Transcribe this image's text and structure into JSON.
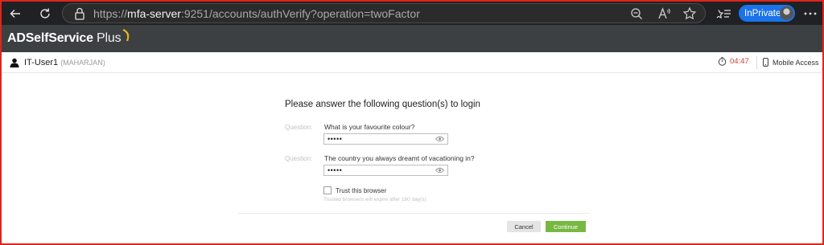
{
  "browser": {
    "url_prefix": "https://",
    "url_host": "mfa-server",
    "url_rest": ":9251/accounts/authVerify?operation=twoFactor",
    "inprivate_label": "InPrivate",
    "icons": [
      "back-arrow-icon",
      "refresh-icon",
      "lock-icon",
      "zoom-out-icon",
      "read-aloud-icon",
      "favorite-star-icon",
      "favorites-icon",
      "more-menu-icon"
    ]
  },
  "app": {
    "logo_main": "ADSelfService",
    "logo_plus": " Plus",
    "brand_colors": {
      "header_bg": "#3d4043",
      "accent_swoosh": "#e8b21c",
      "continue_green": "#77b843"
    }
  },
  "user_bar": {
    "user_name": "IT-User1",
    "user_domain": "(MAHARJAN)",
    "timer": "04:47",
    "mobile_access": "Mobile Access"
  },
  "form": {
    "title": "Please answer the following question(s) to login",
    "questions": [
      {
        "label": "Question:",
        "text": "What is your favourite colour?",
        "answer_masked": "•••••"
      },
      {
        "label": "Question:",
        "text": "The country you always dreamt of vacationing in?",
        "answer_masked": "•••••"
      }
    ],
    "trust_label": "Trust this browser",
    "trust_note": "Trusted browsers will expire after 180 day(s)",
    "trust_checked": false,
    "cancel_label": "Cancel",
    "continue_label": "Continue"
  }
}
